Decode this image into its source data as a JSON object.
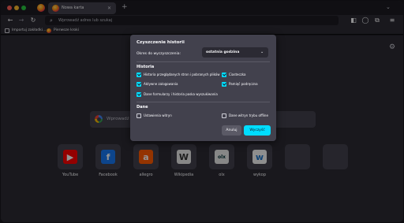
{
  "tabs": {
    "active_title": "Nowa karta",
    "close_glyph": "✕",
    "new_tab_glyph": "+",
    "list_glyph": "⌄"
  },
  "toolbar": {
    "back_glyph": "←",
    "forward_glyph": "→",
    "reload_glyph": "↻",
    "search_icon_glyph": "⌕",
    "url_placeholder": "Wprowadź adres lub szukaj",
    "pocket_glyph": "◧",
    "account_glyph": "◯",
    "extensions_glyph": "⧉",
    "menu_glyph": "≡"
  },
  "bookmarks": [
    {
      "label": "Importuj zakładki…",
      "icon": "import-icon"
    },
    {
      "label": "Pierwsze kroki",
      "icon": "firefox-icon"
    }
  ],
  "content": {
    "settings_glyph": "⚙",
    "search_placeholder": "Wprowadź"
  },
  "tiles": [
    {
      "label": "YouTube",
      "glyph": "▶",
      "bg": "#ff0000",
      "fg": "#ffffff"
    },
    {
      "label": "Facebook",
      "glyph": "f",
      "bg": "#1877f2",
      "fg": "#ffffff"
    },
    {
      "label": "allegro",
      "glyph": "a",
      "bg": "#ff5a00",
      "fg": "#ffffff"
    },
    {
      "label": "Wikipedia",
      "glyph": "W",
      "bg": "#e8e8e8",
      "fg": "#333333"
    },
    {
      "label": "olx",
      "glyph": "olx",
      "bg": "#e8e8e8",
      "fg": "#002f34"
    },
    {
      "label": "wykop",
      "glyph": "w",
      "bg": "#f5f5f5",
      "fg": "#1e74c9"
    },
    {
      "label": "",
      "glyph": "",
      "bg": "transparent",
      "fg": "#ffffff"
    },
    {
      "label": "",
      "glyph": "",
      "bg": "transparent",
      "fg": "#ffffff"
    }
  ],
  "dialog": {
    "title": "Czyszczenie historii",
    "range_label": "Okres do wyczyszczenia:",
    "range_value": "ostatnia godzina",
    "history_heading": "Historia",
    "data_heading": "Dane",
    "history_items": [
      {
        "label": "Historia przeglądanych stron i pobranych plików",
        "checked": true
      },
      {
        "label": "Ciasteczka",
        "checked": true
      },
      {
        "label": "Aktywne zalogowania",
        "checked": true
      },
      {
        "label": "Pamięć podręczna",
        "checked": true
      },
      {
        "label": "Dane formularzy i historia paska wyszukiwania",
        "checked": true
      }
    ],
    "data_items": [
      {
        "label": "Ustawienia witryn",
        "checked": false
      },
      {
        "label": "Dane witryn trybu offline",
        "checked": false
      }
    ],
    "cancel_label": "Anuluj",
    "ok_label": "Wyczyść"
  },
  "colors": {
    "accent": "#00ddff",
    "dialog_bg": "#42414d",
    "page_bg": "#2b2a33"
  }
}
